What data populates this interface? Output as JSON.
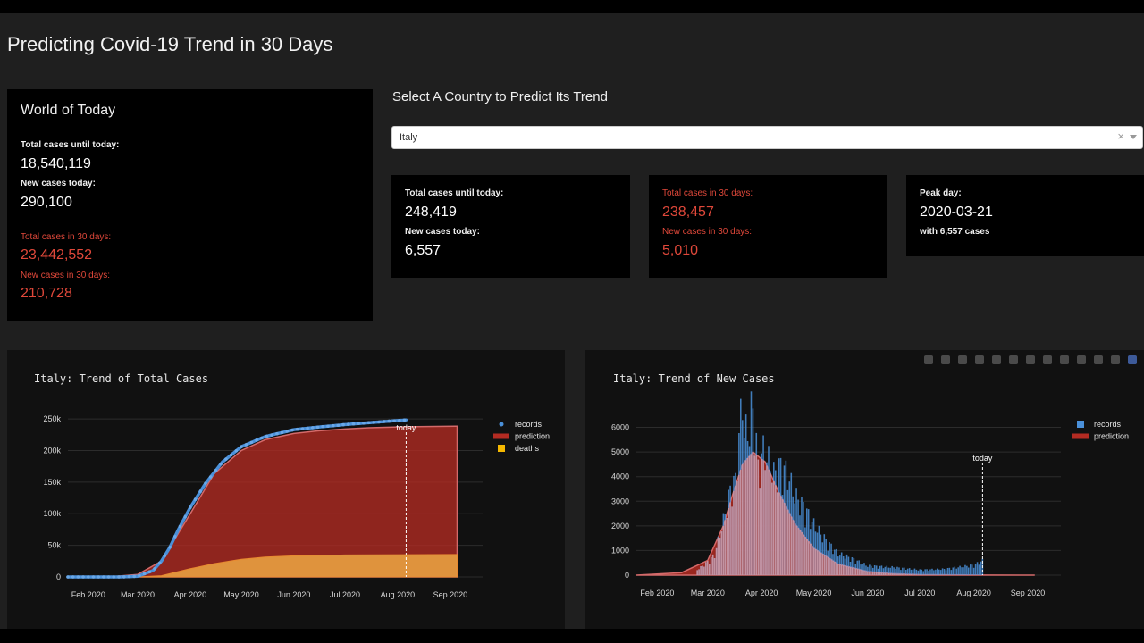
{
  "app_title": "Predicting Covid-19 Trend in 30 Days",
  "world": {
    "title": "World of Today",
    "total_label": "Total cases until today:",
    "total_value": "18,540,119",
    "new_label": "New cases today:",
    "new_value": "290,100",
    "pred_total_label": "Total cases in 30 days:",
    "pred_total_value": "23,442,552",
    "pred_new_label": "New cases in 30 days:",
    "pred_new_value": "210,728"
  },
  "country": {
    "prompt": "Select A Country to Predict Its Trend",
    "selected": "Italy",
    "clear_glyph": "×",
    "stats": {
      "total_label": "Total cases until today:",
      "total_value": "248,419",
      "new_label": "New cases today:",
      "new_value": "6,557",
      "pred_total_label": "Total cases in 30 days:",
      "pred_total_value": "238,457",
      "pred_new_label": "New cases in 30 days:",
      "pred_new_value": "5,010",
      "peak_label": "Peak day:",
      "peak_value": "2020-03-21",
      "peak_sub": "with 6,557 cases"
    }
  },
  "colors": {
    "records": "#4a90d9",
    "prediction": "#b32b22",
    "deaths": "#f5b800",
    "red_text": "#e0483a",
    "panel": "#111111",
    "card": "#000000"
  },
  "modebar_icons": [
    "camera-icon",
    "zoom-icon",
    "pan-icon",
    "box-select-icon",
    "lasso-icon",
    "zoom-in-icon",
    "zoom-out-icon",
    "autoscale-icon",
    "reset-axes-icon",
    "spike-lines-icon",
    "hover-closest-icon",
    "hover-compare-icon",
    "plotly-logo-icon"
  ],
  "chart_data": [
    {
      "type": "area",
      "title": "Italy: Trend of Total Cases",
      "x_ticks": [
        "Feb 2020",
        "Mar 2020",
        "Apr 2020",
        "May 2020",
        "Jun 2020",
        "Jul 2020",
        "Aug 2020",
        "Sep 2020"
      ],
      "y_ticks": [
        "0",
        "50k",
        "100k",
        "150k",
        "200k",
        "250k"
      ],
      "ylim": [
        0,
        260000
      ],
      "today_label": "today",
      "today_date": "2020-08-06",
      "legend": [
        "records",
        "prediction",
        "deaths"
      ],
      "series": [
        {
          "name": "records",
          "kind": "scatter-line",
          "points": [
            [
              "2020-01-20",
              0
            ],
            [
              "2020-02-20",
              0
            ],
            [
              "2020-03-01",
              1000
            ],
            [
              "2020-03-10",
              10000
            ],
            [
              "2020-03-15",
              25000
            ],
            [
              "2020-03-20",
              47000
            ],
            [
              "2020-03-25",
              75000
            ],
            [
              "2020-04-01",
              110000
            ],
            [
              "2020-04-10",
              148000
            ],
            [
              "2020-04-20",
              182000
            ],
            [
              "2020-05-01",
              206000
            ],
            [
              "2020-05-15",
              222000
            ],
            [
              "2020-06-01",
              233000
            ],
            [
              "2020-06-15",
              237000
            ],
            [
              "2020-07-01",
              241000
            ],
            [
              "2020-07-15",
              244000
            ],
            [
              "2020-08-06",
              248419
            ]
          ]
        },
        {
          "name": "prediction",
          "kind": "area",
          "points": [
            [
              "2020-01-20",
              0
            ],
            [
              "2020-02-15",
              500
            ],
            [
              "2020-03-01",
              4000
            ],
            [
              "2020-03-15",
              25000
            ],
            [
              "2020-04-01",
              100000
            ],
            [
              "2020-04-15",
              163000
            ],
            [
              "2020-05-01",
              200000
            ],
            [
              "2020-05-15",
              217000
            ],
            [
              "2020-06-01",
              227000
            ],
            [
              "2020-06-15",
              231000
            ],
            [
              "2020-07-01",
              234000
            ],
            [
              "2020-07-15",
              236000
            ],
            [
              "2020-08-06",
              237500
            ],
            [
              "2020-09-05",
              238457
            ]
          ]
        },
        {
          "name": "deaths",
          "kind": "area",
          "points": [
            [
              "2020-01-20",
              0
            ],
            [
              "2020-03-01",
              0
            ],
            [
              "2020-03-15",
              2000
            ],
            [
              "2020-04-01",
              13000
            ],
            [
              "2020-04-15",
              21000
            ],
            [
              "2020-05-01",
              28000
            ],
            [
              "2020-05-15",
              31500
            ],
            [
              "2020-06-01",
              33400
            ],
            [
              "2020-07-01",
              34700
            ],
            [
              "2020-08-06",
              35200
            ],
            [
              "2020-09-05",
              35500
            ]
          ]
        }
      ]
    },
    {
      "type": "bar",
      "title": "Italy: Trend of New Cases",
      "x_ticks": [
        "Feb 2020",
        "Mar 2020",
        "Apr 2020",
        "May 2020",
        "Jun 2020",
        "Jul 2020",
        "Aug 2020",
        "Sep 2020"
      ],
      "y_ticks": [
        "0",
        "1000",
        "2000",
        "3000",
        "4000",
        "5000",
        "6000"
      ],
      "ylim": [
        0,
        6600
      ],
      "today_label": "today",
      "today_date": "2020-08-06",
      "legend": [
        "records",
        "prediction"
      ],
      "series": [
        {
          "name": "records",
          "kind": "bar",
          "points": [
            [
              "2020-02-24",
              200
            ],
            [
              "2020-03-01",
              500
            ],
            [
              "2020-03-05",
              770
            ],
            [
              "2020-03-09",
              1800
            ],
            [
              "2020-03-12",
              2600
            ],
            [
              "2020-03-15",
              3500
            ],
            [
              "2020-03-17",
              3500
            ],
            [
              "2020-03-19",
              5300
            ],
            [
              "2020-03-20",
              5900
            ],
            [
              "2020-03-21",
              6557
            ],
            [
              "2020-03-22",
              5500
            ],
            [
              "2020-03-24",
              5200
            ],
            [
              "2020-03-26",
              6200
            ],
            [
              "2020-03-28",
              5900
            ],
            [
              "2020-03-30",
              4000
            ],
            [
              "2020-04-02",
              4700
            ],
            [
              "2020-04-05",
              4300
            ],
            [
              "2020-04-08",
              3800
            ],
            [
              "2020-04-12",
              4100
            ],
            [
              "2020-04-16",
              3800
            ],
            [
              "2020-04-20",
              3000
            ],
            [
              "2020-04-25",
              2600
            ],
            [
              "2020-05-01",
              1900
            ],
            [
              "2020-05-08",
              1300
            ],
            [
              "2020-05-15",
              800
            ],
            [
              "2020-05-22",
              650
            ],
            [
              "2020-06-01",
              350
            ],
            [
              "2020-06-15",
              300
            ],
            [
              "2020-07-01",
              200
            ],
            [
              "2020-07-15",
              230
            ],
            [
              "2020-08-01",
              380
            ],
            [
              "2020-08-06",
              550
            ]
          ]
        },
        {
          "name": "prediction",
          "kind": "area",
          "points": [
            [
              "2020-01-20",
              0
            ],
            [
              "2020-02-15",
              100
            ],
            [
              "2020-03-01",
              600
            ],
            [
              "2020-03-10",
              2000
            ],
            [
              "2020-03-15",
              3200
            ],
            [
              "2020-03-21",
              4500
            ],
            [
              "2020-03-27",
              5000
            ],
            [
              "2020-04-03",
              4600
            ],
            [
              "2020-04-10",
              3500
            ],
            [
              "2020-04-20",
              2100
            ],
            [
              "2020-05-01",
              1100
            ],
            [
              "2020-05-15",
              450
            ],
            [
              "2020-06-01",
              150
            ],
            [
              "2020-06-15",
              60
            ],
            [
              "2020-07-01",
              20
            ],
            [
              "2020-08-06",
              5
            ],
            [
              "2020-09-05",
              0
            ]
          ]
        }
      ]
    }
  ]
}
